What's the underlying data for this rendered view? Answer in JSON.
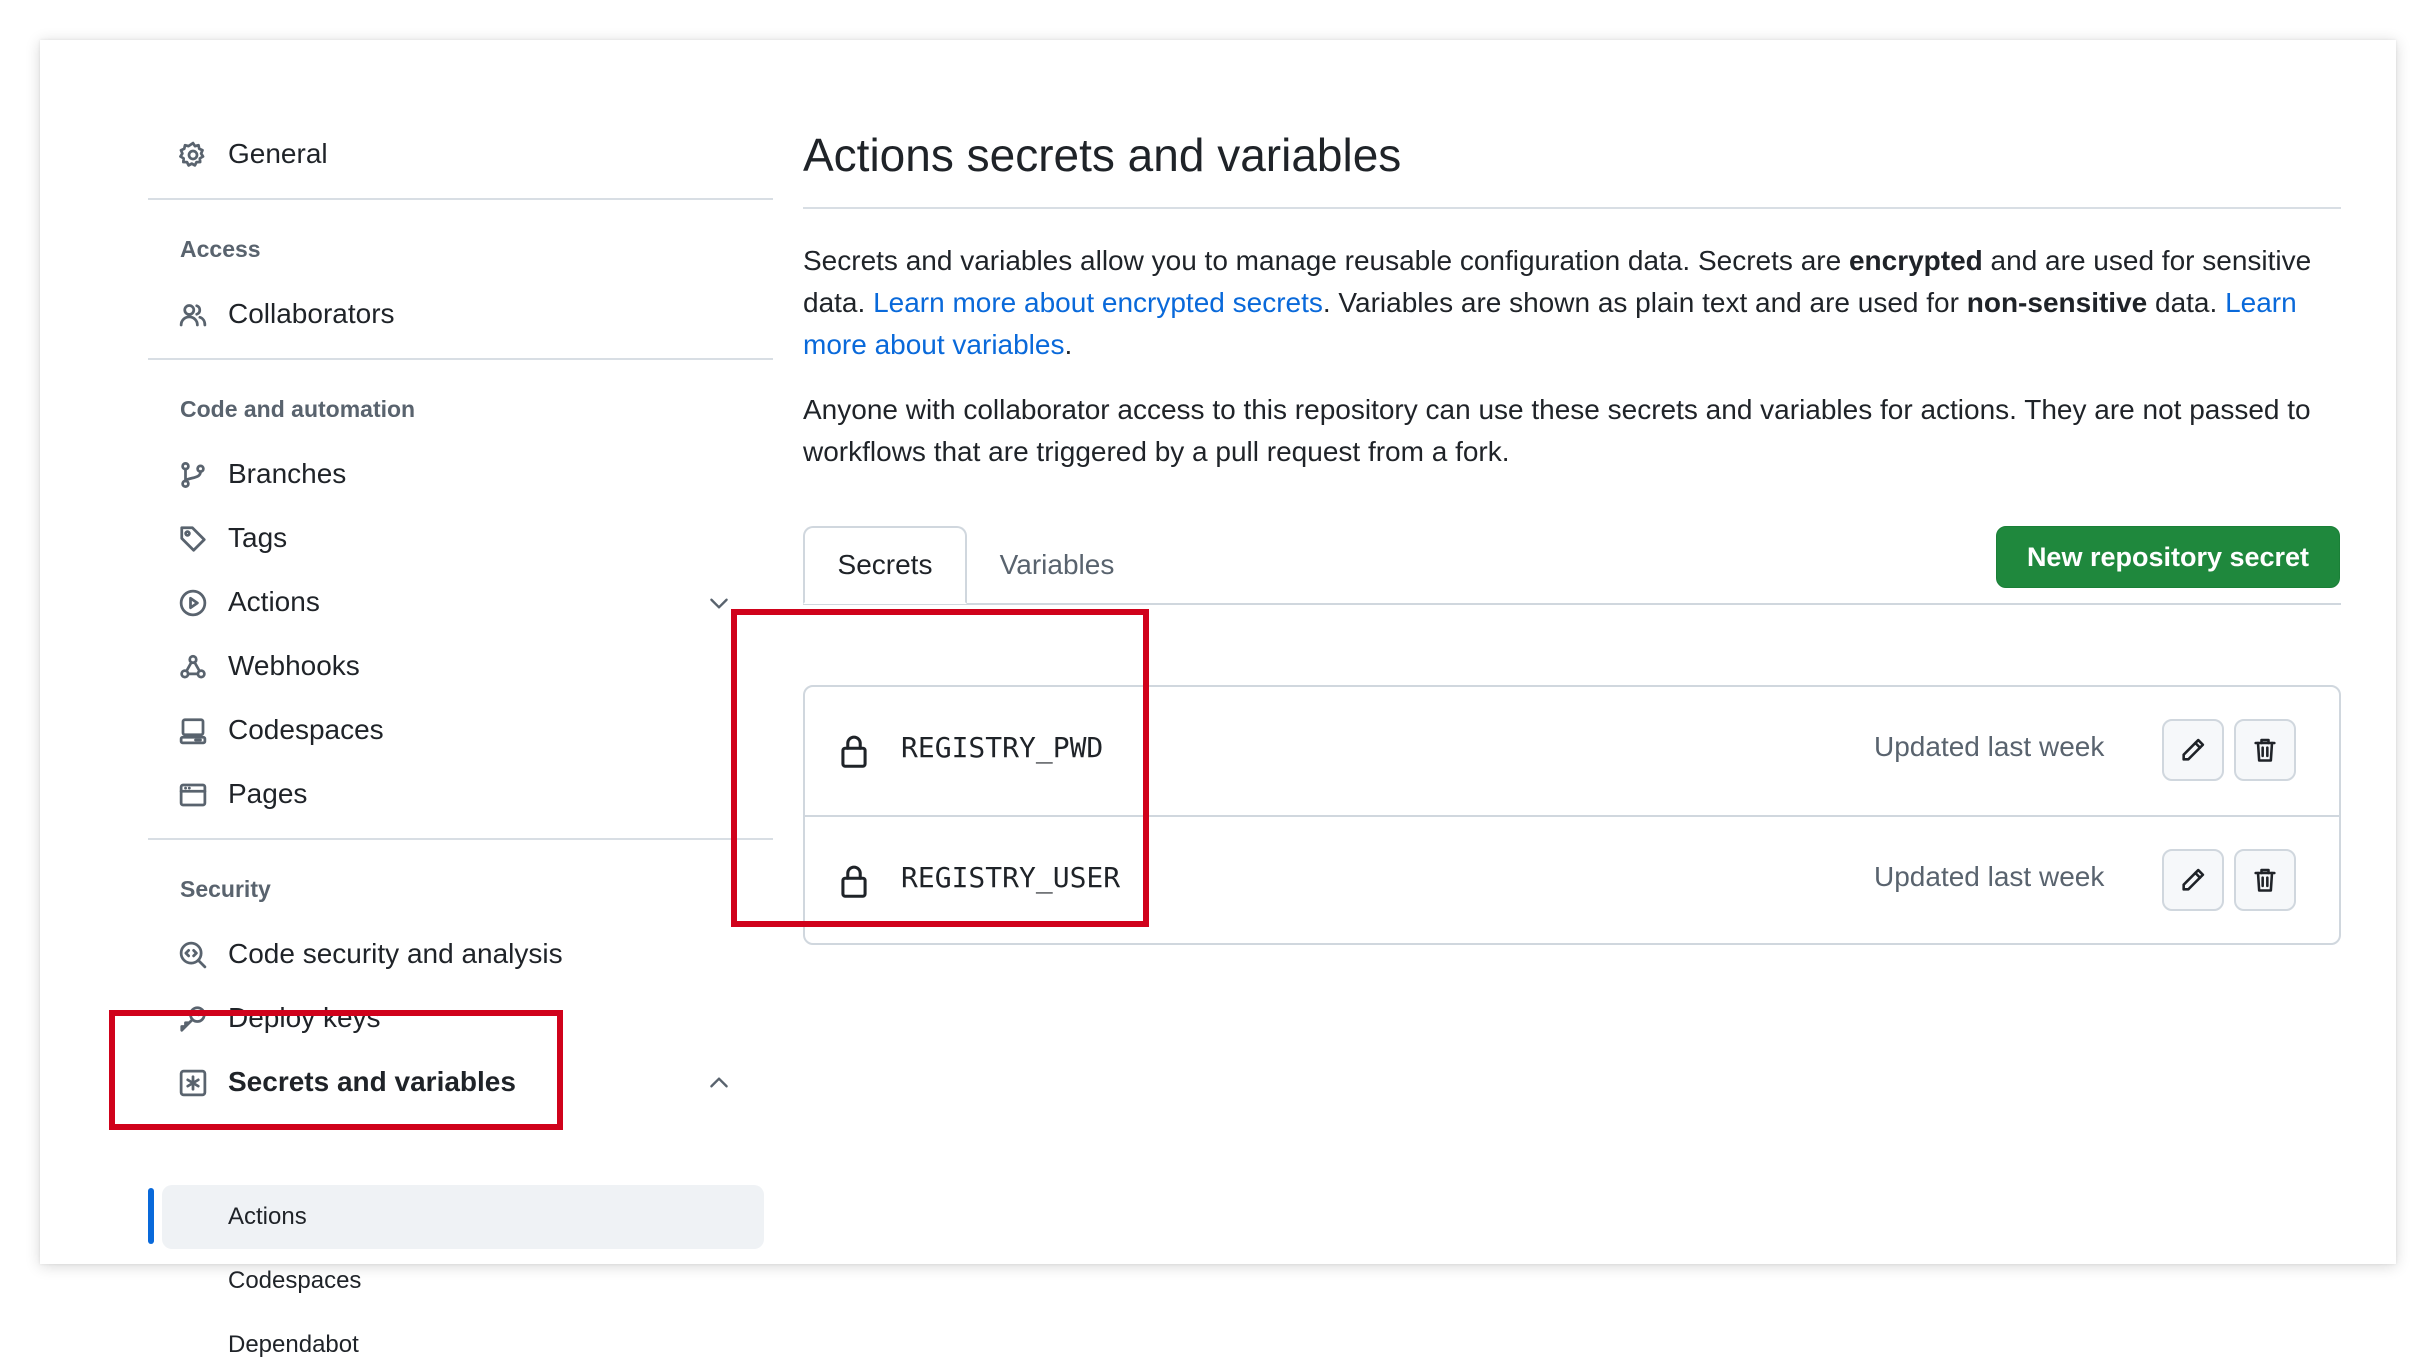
{
  "sidebar": {
    "general": "General",
    "access_title": "Access",
    "collaborators": "Collaborators",
    "code_title": "Code and automation",
    "branches": "Branches",
    "tags": "Tags",
    "actions": "Actions",
    "webhooks": "Webhooks",
    "codespaces": "Codespaces",
    "pages": "Pages",
    "security_title": "Security",
    "code_security": "Code security and analysis",
    "deploy_keys": "Deploy keys",
    "secrets_variables": "Secrets and variables",
    "sub_items": [
      "Actions",
      "Codespaces",
      "Dependabot"
    ]
  },
  "main": {
    "title": "Actions secrets and variables",
    "intro": {
      "t1": "Secrets and variables allow you to manage reusable configuration data. Secrets are ",
      "b1": "encrypted",
      "t2": " and are used for sensitive data. ",
      "link1": "Learn more about encrypted secrets",
      "t3": ". Variables are shown as plain text and are used for ",
      "b2": "non-sensitive",
      "t4": " data. ",
      "link2": "Learn more about variables",
      "t5": "."
    },
    "notice": "Anyone with collaborator access to this repository can use these secrets and variables for actions. They are not passed to workflows that are triggered by a pull request from a fork.",
    "tabs": [
      "Secrets",
      "Variables"
    ],
    "new_button": "New repository secret",
    "secrets": [
      {
        "name": "REGISTRY_PWD",
        "updated": "Updated last week"
      },
      {
        "name": "REGISTRY_USER",
        "updated": "Updated last week"
      }
    ]
  },
  "colors": {
    "accent_link": "#0969da",
    "primary_button": "#1f883d",
    "highlight_box": "#d0021b"
  },
  "icons": [
    "gear-icon",
    "people-icon",
    "git-branch-icon",
    "tag-icon",
    "play-icon",
    "webhook-icon",
    "codespaces-icon",
    "browser-icon",
    "codescan-icon",
    "key-icon",
    "key-asterisk-icon",
    "chevron-down-icon",
    "chevron-up-icon",
    "lock-icon",
    "pencil-icon",
    "trash-icon"
  ]
}
